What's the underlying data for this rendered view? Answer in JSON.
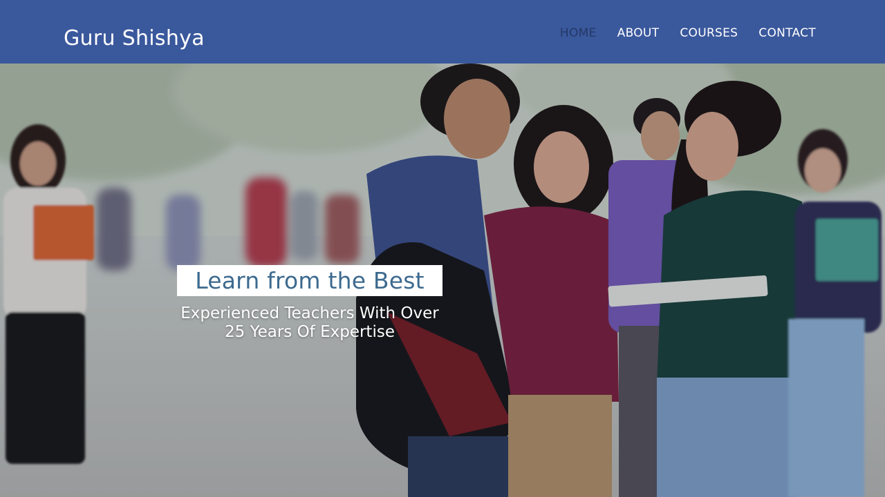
{
  "brand": {
    "name": "Guru Shishya"
  },
  "nav": {
    "items": [
      {
        "label": "HOME",
        "active": true
      },
      {
        "label": "ABOUT",
        "active": false
      },
      {
        "label": "COURSES",
        "active": false
      },
      {
        "label": "CONTACT",
        "active": false
      }
    ]
  },
  "hero": {
    "title": "Learn from the Best",
    "subtitle_line1": "Experienced Teachers With Over",
    "subtitle_line2": "25 Years Of Expertise",
    "image": "students-on-campus-photo"
  },
  "colors": {
    "navbar_bg": "#3a589c",
    "active_nav": "#233a66",
    "title_text": "#3d6a8f",
    "title_box": "#ffffff"
  }
}
